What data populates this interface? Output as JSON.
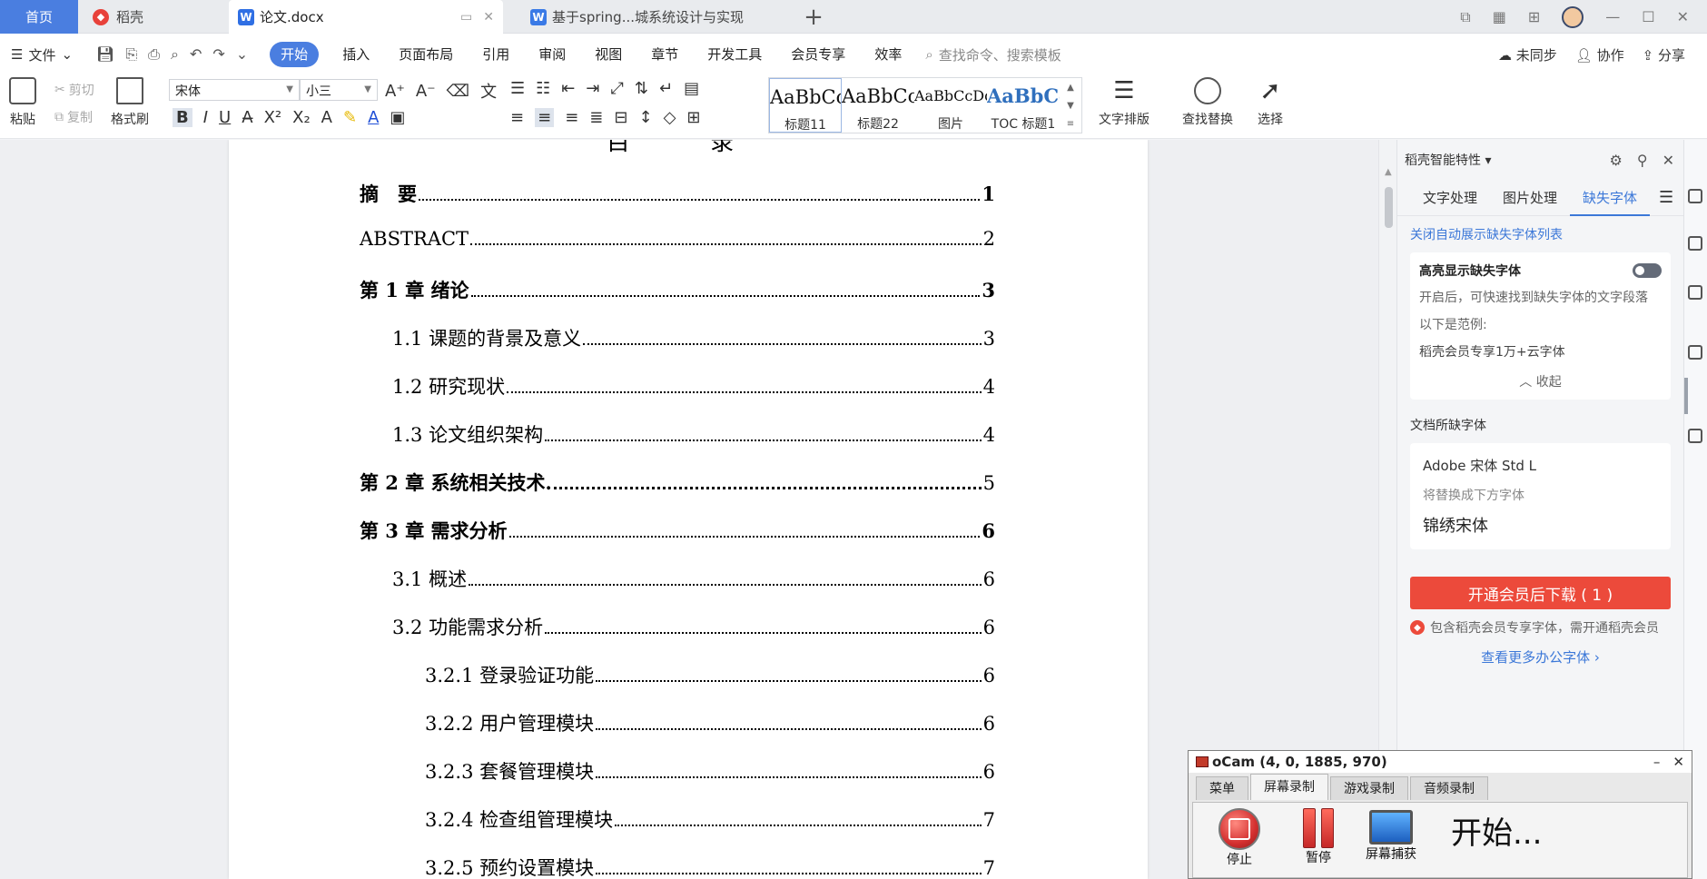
{
  "tabs": {
    "home": "首页",
    "daoke": "稻壳",
    "active_doc": "论文.docx",
    "other_doc": "基于spring...城系统设计与实现",
    "add": "+"
  },
  "menu": {
    "file": "文件",
    "items": [
      "开始",
      "插入",
      "页面布局",
      "引用",
      "审阅",
      "视图",
      "章节",
      "开发工具",
      "会员专享",
      "效率"
    ],
    "search_placeholder": "查找命令、搜索模板",
    "right": [
      "未同步",
      "协作",
      "分享"
    ]
  },
  "ribbon": {
    "paste": "粘贴",
    "cut": "剪切",
    "copy": "复制",
    "format_painter": "格式刷",
    "font_name": "宋体",
    "font_size": "小三",
    "styles": [
      {
        "preview": "AaBbCc",
        "label": "标题11"
      },
      {
        "preview": "AaBbCcI",
        "label": "标题22"
      },
      {
        "preview": "AaBbCcDd",
        "label": "图片"
      },
      {
        "preview": "AaBbCc",
        "label": "TOC 标题1"
      }
    ],
    "text_layout": "文字排版",
    "find_replace": "查找替换",
    "select": "选择"
  },
  "document": {
    "toc_title": "目 录",
    "entries": [
      {
        "text": "摘　要",
        "page": "1",
        "level": 0
      },
      {
        "text": "ABSTRACT",
        "page": "2",
        "level": 0
      },
      {
        "text": "第 1 章  绪论",
        "page": "3",
        "level": 0
      },
      {
        "text": "1.1 课题的背景及意义",
        "page": "3",
        "level": 1
      },
      {
        "text": "1.2  研究现状",
        "page": "4",
        "level": 1
      },
      {
        "text": "1.3  论文组织架构",
        "page": "4",
        "level": 1
      },
      {
        "text": "第 2 章  系统相关技术.",
        "page": "5",
        "level": 0
      },
      {
        "text": "第 3 章  需求分析",
        "page": "6",
        "level": 0
      },
      {
        "text": "3.1  概述",
        "page": "6",
        "level": 1
      },
      {
        "text": "3.2  功能需求分析",
        "page": "6",
        "level": 1
      },
      {
        "text": "3.2.1  登录验证功能",
        "page": "6",
        "level": 2
      },
      {
        "text": "3.2.2  用户管理模块",
        "page": "6",
        "level": 2
      },
      {
        "text": "3.2.3  套餐管理模块",
        "page": "6",
        "level": 2
      },
      {
        "text": "3.2.4  检查组管理模块",
        "page": "7",
        "level": 2
      },
      {
        "text": "3.2.5  预约设置模块",
        "page": "7",
        "level": 2
      }
    ]
  },
  "panel": {
    "header": "稻壳智能特性",
    "tabs": [
      "文字处理",
      "图片处理",
      "缺失字体"
    ],
    "auto_show_link": "关闭自动展示缺失字体列表",
    "highlight_title": "高亮显示缺失字体",
    "highlight_desc": "开启后，可快速找到缺失字体的文字段落",
    "example_label": "以下是范例:",
    "example_value": "稻壳会员专享1万+云字体",
    "collapse": "收起",
    "missing_title": "文档所缺字体",
    "missing_font": "Adobe 宋体 Std L",
    "replace_label": "将替换成下方字体",
    "replace_font": "锦绣宋体",
    "cta": "开通会员后下载 ( 1 )",
    "notice": "包含稻壳会员专享字体，需开通稻壳会员",
    "more_link": "查看更多办公字体"
  },
  "ocam": {
    "title": "oCam (4, 0, 1885, 970)",
    "tabs": [
      "菜单",
      "屏幕录制",
      "游戏录制",
      "音频录制"
    ],
    "stop": "停止",
    "pause": "暂停",
    "capture": "屏幕捕获",
    "status": "开始..."
  },
  "colors": {
    "accent": "#4a7ee0",
    "cta": "#ec4a3b",
    "link": "#3c78d8"
  }
}
